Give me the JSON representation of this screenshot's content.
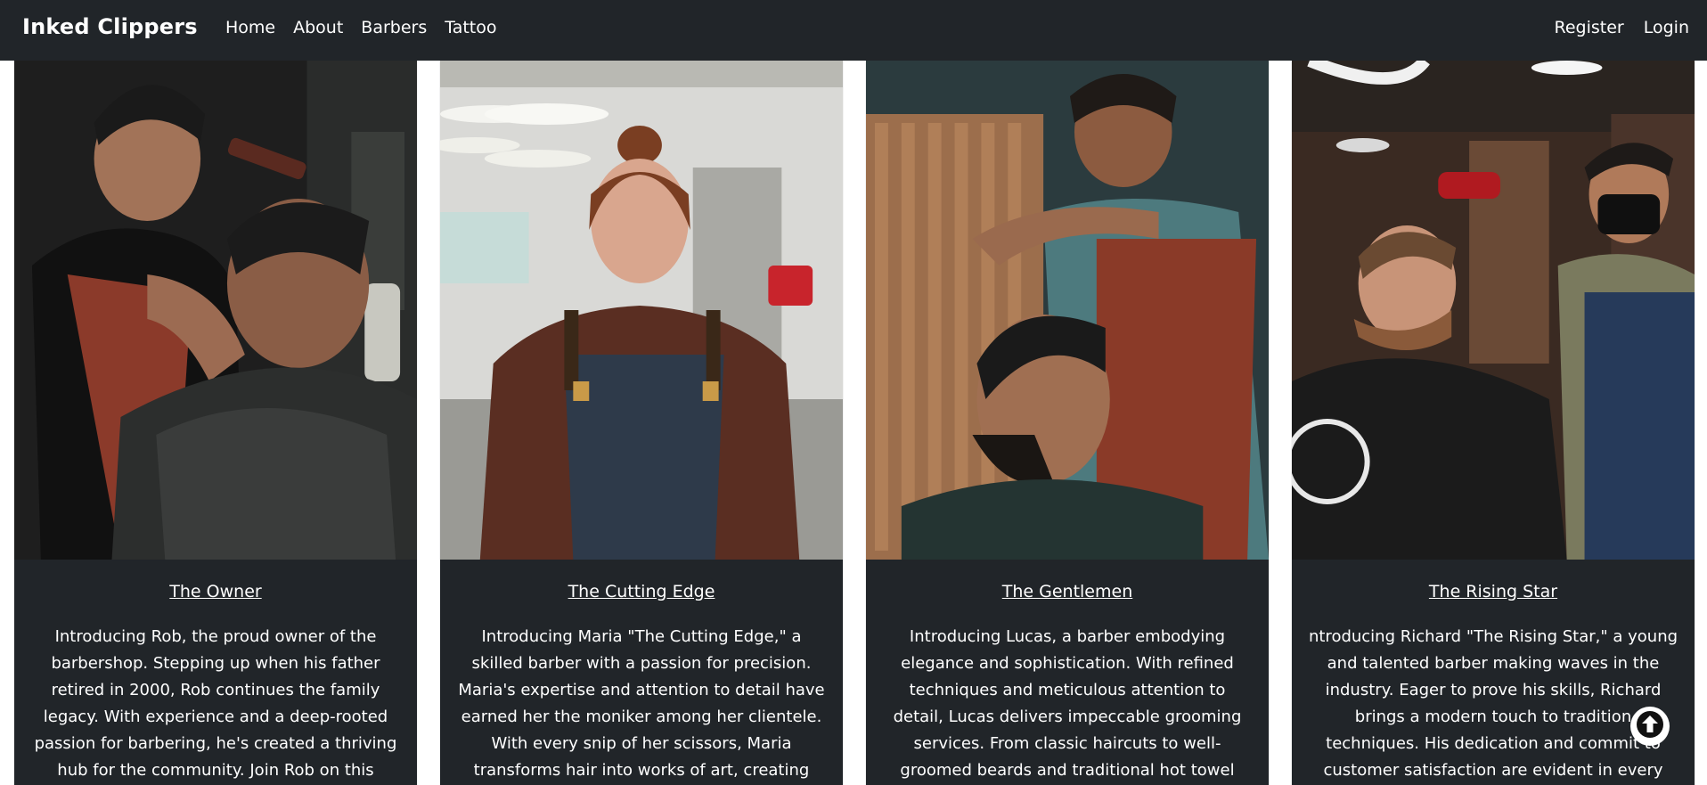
{
  "nav": {
    "brand": "Inked Clippers",
    "links": [
      "Home",
      "About",
      "Barbers",
      "Tattoo"
    ],
    "right_links": [
      "Register",
      "Login"
    ]
  },
  "cards": [
    {
      "title": "The Owner",
      "text": "Introducing Rob, the proud owner of the barbershop. Stepping up when his father retired in 2000, Rob continues the family legacy. With experience and a deep-rooted passion for barbering, he's created a thriving hub for the community. Join Rob on this"
    },
    {
      "title": "The Cutting Edge",
      "text": "Introducing Maria \"The Cutting Edge,\" a skilled barber with a passion for precision. Maria's expertise and attention to detail have earned her the moniker among her clientele. With every snip of her scissors, Maria transforms hair into works of art, creating"
    },
    {
      "title": "The Gentlemen",
      "text": "Introducing Lucas, a barber embodying elegance and sophistication. With refined techniques and meticulous attention to detail, Lucas delivers impeccable grooming services. From classic haircuts to well-groomed beards and traditional hot towel shaves, he ensures"
    },
    {
      "title": "The Rising Star",
      "text": "ntroducing Richard \"The Rising Star,\" a young and talented barber making waves in the industry. Eager to prove his skills, Richard brings a modern touch to tradition techniques. His dedication and commit to customer satisfaction are evident in every"
    }
  ],
  "icons": {
    "scroll_top": "arrow-up-circle-icon"
  }
}
